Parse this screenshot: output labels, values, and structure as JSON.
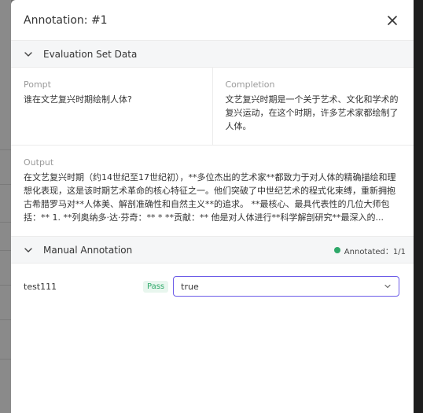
{
  "dialog": {
    "title": "Annotation: #1"
  },
  "evaluation_section": {
    "title": "Evaluation Set Data",
    "prompt_label": "Pompt",
    "prompt_value": "谁在文艺复兴时期绘制人体?",
    "completion_label": "Completion",
    "completion_value": "文艺复兴时期是一个关于艺术、文化和学术的复兴运动，在这个时期，许多艺术家都绘制了人体。",
    "output_label": "Output",
    "output_value": "在文艺复兴时期（约14世纪至17世纪初），**多位杰出的艺术家**都致力于对人体的精确描绘和理想化表现，这是该时期艺术革命的核心特征之一。他们突破了中世纪艺术的程式化束缚，重新拥抱古希腊罗马对**人体美、解剖准确性和自然主义**的追求。 **最核心、最具代表性的几位大师包括：** 1. **列奥纳多·达·芬奇：** * **贡献：** 他是对人体进行**科学解剖研究**最深入的..."
  },
  "manual_section": {
    "title": "Manual Annotation",
    "status_text": "Annotated：1/1",
    "status_color": "#2ea869",
    "rows": [
      {
        "name": "test111",
        "badge": "Pass",
        "value": "true"
      }
    ]
  },
  "colors": {
    "accent": "#6c5ce7",
    "pass": "#2ea869"
  }
}
